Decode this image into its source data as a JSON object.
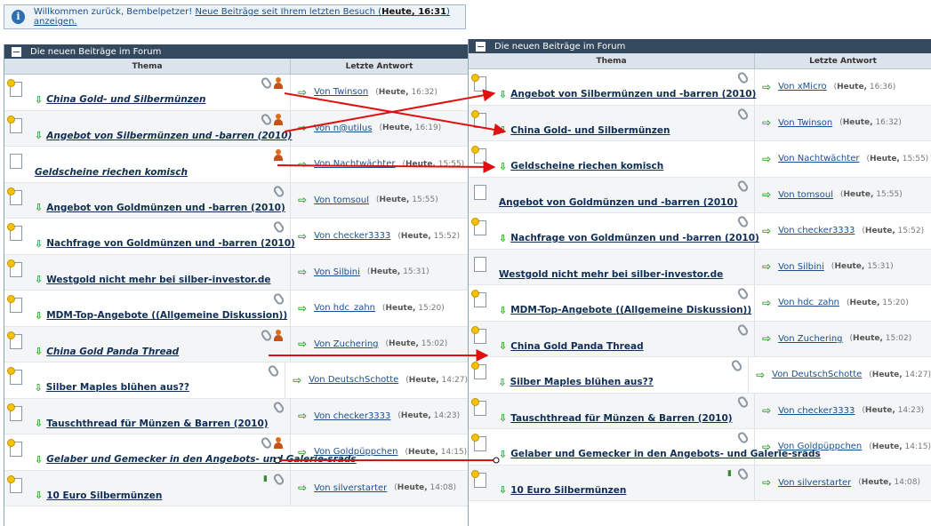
{
  "welcome": {
    "text": "Willkommen zurück, Bembelpetzer!",
    "link_pre": "Neue Beiträge seit Ihrem letzten Besuch (",
    "link_bold": "Heute, 16:31",
    "link_post": ") anzeigen."
  },
  "left": {
    "title": "Die neuen Beiträge im Forum",
    "col_topic": "Thema",
    "col_last": "Letzte Antwort",
    "rows": [
      {
        "title": "China Gold- und Silbermünzen",
        "italic": true,
        "unread": true,
        "goto": true,
        "icons": [
          "clip",
          "user"
        ],
        "author": "Von Twinson",
        "day": "Heute,",
        "time": "16:32"
      },
      {
        "title": "Angebot von Silbermünzen und -barren (2010)",
        "italic": true,
        "unread": true,
        "goto": true,
        "icons": [
          "clip",
          "user"
        ],
        "author": "Von n@utilus",
        "day": "Heute,",
        "time": "16:19"
      },
      {
        "title": "Geldscheine riechen komisch",
        "italic": true,
        "unread": false,
        "goto": false,
        "icons": [
          "user"
        ],
        "author": "Von Nachtwächter",
        "day": "Heute,",
        "time": "15:55"
      },
      {
        "title": "Angebot von Goldmünzen und -barren (2010)",
        "italic": false,
        "unread": true,
        "goto": true,
        "icons": [
          "clip"
        ],
        "author": "Von tomsoul",
        "day": "Heute,",
        "time": "15:55"
      },
      {
        "title": "Nachfrage von Goldmünzen und -barren (2010)",
        "italic": false,
        "unread": true,
        "goto": true,
        "icons": [
          "clip"
        ],
        "author": "Von checker3333",
        "day": "Heute,",
        "time": "15:52"
      },
      {
        "title": "Westgold nicht mehr bei silber-investor.de",
        "italic": false,
        "unread": true,
        "goto": true,
        "icons": [],
        "author": "Von Silbini",
        "day": "Heute,",
        "time": "15:31"
      },
      {
        "title": "MDM-Top-Angebote ((Allgemeine Diskussion))",
        "italic": false,
        "unread": true,
        "goto": true,
        "icons": [
          "clip"
        ],
        "author": "Von hdc_zahn",
        "day": "Heute,",
        "time": "15:20"
      },
      {
        "title": "China Gold Panda Thread",
        "italic": true,
        "unread": true,
        "goto": true,
        "icons": [
          "clip",
          "user"
        ],
        "author": "Von Zuchering",
        "day": "Heute,",
        "time": "15:02"
      },
      {
        "title": "Silber Maples blühen aus??",
        "italic": false,
        "unread": true,
        "goto": true,
        "icons": [
          "clip"
        ],
        "author": "Von DeutschSchotte",
        "day": "Heute,",
        "time": "14:27"
      },
      {
        "title": "Tauschthread für Münzen & Barren (2010)",
        "italic": false,
        "unread": true,
        "goto": true,
        "icons": [
          "clip"
        ],
        "author": "Von checker3333",
        "day": "Heute,",
        "time": "14:23"
      },
      {
        "title": "Gelaber und Gemecker in den Angebots- und Galerie-sräds",
        "italic": true,
        "unread": true,
        "goto": true,
        "icons": [
          "clip",
          "user"
        ],
        "author": "Von Goldpüppchen",
        "day": "Heute,",
        "time": "14:15"
      },
      {
        "title": "10 Euro Silbermünzen",
        "italic": false,
        "unread": true,
        "goto": true,
        "icons": [
          "stats",
          "clip"
        ],
        "author": "Von silverstarter",
        "day": "Heute,",
        "time": "14:08"
      }
    ]
  },
  "right": {
    "title": "Die neuen Beiträge im Forum",
    "col_topic": "Thema",
    "col_last": "Letzte Antwort",
    "rows": [
      {
        "title": "Angebot von Silbermünzen und -barren (2010)",
        "italic": false,
        "unread": true,
        "goto": true,
        "icons": [
          "clip"
        ],
        "author": "Von xMicro",
        "day": "Heute,",
        "time": "16:36"
      },
      {
        "title": "China Gold- und Silbermünzen",
        "italic": false,
        "unread": true,
        "goto": true,
        "icons": [
          "clip"
        ],
        "author": "Von Twinson",
        "day": "Heute,",
        "time": "16:32"
      },
      {
        "title": "Geldscheine riechen komisch",
        "italic": false,
        "unread": true,
        "goto": true,
        "icons": [],
        "author": "Von Nachtwächter",
        "day": "Heute,",
        "time": "15:55"
      },
      {
        "title": "Angebot von Goldmünzen und -barren (2010)",
        "italic": false,
        "unread": false,
        "goto": false,
        "icons": [
          "clip"
        ],
        "author": "Von tomsoul",
        "day": "Heute,",
        "time": "15:55"
      },
      {
        "title": "Nachfrage von Goldmünzen und -barren (2010)",
        "italic": false,
        "unread": true,
        "goto": true,
        "icons": [
          "clip"
        ],
        "author": "Von checker3333",
        "day": "Heute,",
        "time": "15:52"
      },
      {
        "title": "Westgold nicht mehr bei silber-investor.de",
        "italic": false,
        "unread": false,
        "goto": false,
        "icons": [],
        "author": "Von Silbini",
        "day": "Heute,",
        "time": "15:31"
      },
      {
        "title": "MDM-Top-Angebote ((Allgemeine Diskussion))",
        "italic": false,
        "unread": true,
        "goto": true,
        "icons": [
          "clip"
        ],
        "author": "Von hdc_zahn",
        "day": "Heute,",
        "time": "15:20"
      },
      {
        "title": "China Gold Panda Thread",
        "italic": false,
        "unread": true,
        "goto": true,
        "icons": [
          "clip"
        ],
        "author": "Von Zuchering",
        "day": "Heute,",
        "time": "15:02"
      },
      {
        "title": "Silber Maples blühen aus??",
        "italic": false,
        "unread": true,
        "goto": true,
        "icons": [
          "clip"
        ],
        "author": "Von DeutschSchotte",
        "day": "Heute,",
        "time": "14:27"
      },
      {
        "title": "Tauschthread für Münzen & Barren (2010)",
        "italic": false,
        "unread": true,
        "goto": true,
        "icons": [
          "clip"
        ],
        "author": "Von checker3333",
        "day": "Heute,",
        "time": "14:23"
      },
      {
        "title": "Gelaber und Gemecker in den Angebots- und Galerie-sräds",
        "italic": false,
        "unread": true,
        "goto": true,
        "icons": [
          "clip"
        ],
        "author": "Von Goldpüppchen",
        "day": "Heute,",
        "time": "14:15"
      },
      {
        "title": "10 Euro Silbermünzen",
        "italic": false,
        "unread": true,
        "goto": true,
        "icons": [
          "stats",
          "clip"
        ],
        "author": "Von silverstarter",
        "day": "Heute,",
        "time": "14:08"
      }
    ]
  },
  "annotation": {
    "color": "#e01010"
  }
}
